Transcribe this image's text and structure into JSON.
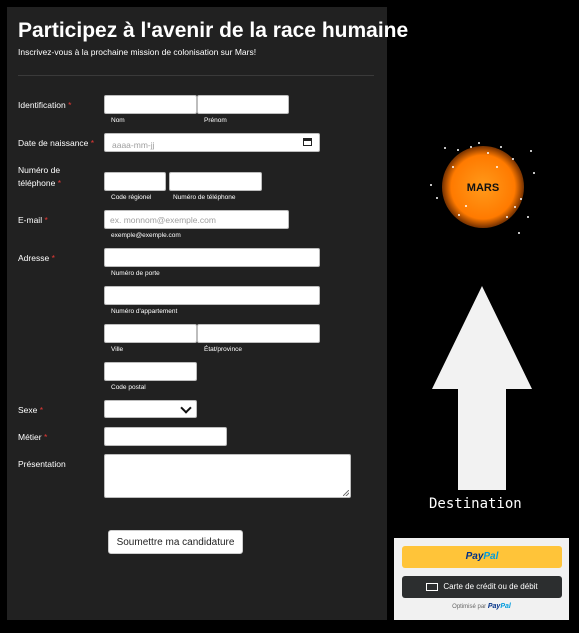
{
  "form": {
    "title": "Participez à l'avenir de la race humaine",
    "subtitle": "Inscrivez-vous à la prochaine mission de colonisation sur Mars!",
    "required_mark": "*",
    "fields": {
      "identification": {
        "label": "Identification",
        "hint_last": "Nom",
        "hint_first": "Prénom"
      },
      "birthdate": {
        "label": "Date de naissance",
        "placeholder": "aaaa-mm-jj"
      },
      "phone": {
        "label_line1": "Numéro de",
        "label_line2": "téléphone",
        "hint_area": "Code régionel",
        "hint_number": "Numéro de téléphone"
      },
      "email": {
        "label": "E-mail",
        "placeholder": "ex. monnom@exemple.com",
        "hint": "exemple@exemple.com"
      },
      "address": {
        "label": "Adresse",
        "hint_street": "Numéro de porte",
        "hint_apartment": "Numéro d'appartement",
        "hint_city": "Ville",
        "hint_state": "État/province",
        "hint_postal": "Code postal"
      },
      "sex": {
        "label": "Sexe",
        "value": ""
      },
      "job": {
        "label": "Métier"
      },
      "presentation": {
        "label": "Présentation"
      }
    },
    "submit_label": "Soumettre ma candidature"
  },
  "sidebar": {
    "planet_label": "MARS",
    "planet_color": "#ff8c00",
    "arrow_icon": "arrow-up-icon",
    "arrow_color": "#f2f2f2",
    "destination_label": "Destination"
  },
  "payment": {
    "paypal_button": {
      "part1": "Pay",
      "part2": "Pal"
    },
    "card_button_label": "Carte de crédit ou de débit",
    "card_icon": "credit-card-icon",
    "powered_by": "Optimisé par",
    "paypal_colors": {
      "button_bg": "#ffc439",
      "dark_blue": "#003087",
      "light_blue": "#009cde"
    }
  }
}
